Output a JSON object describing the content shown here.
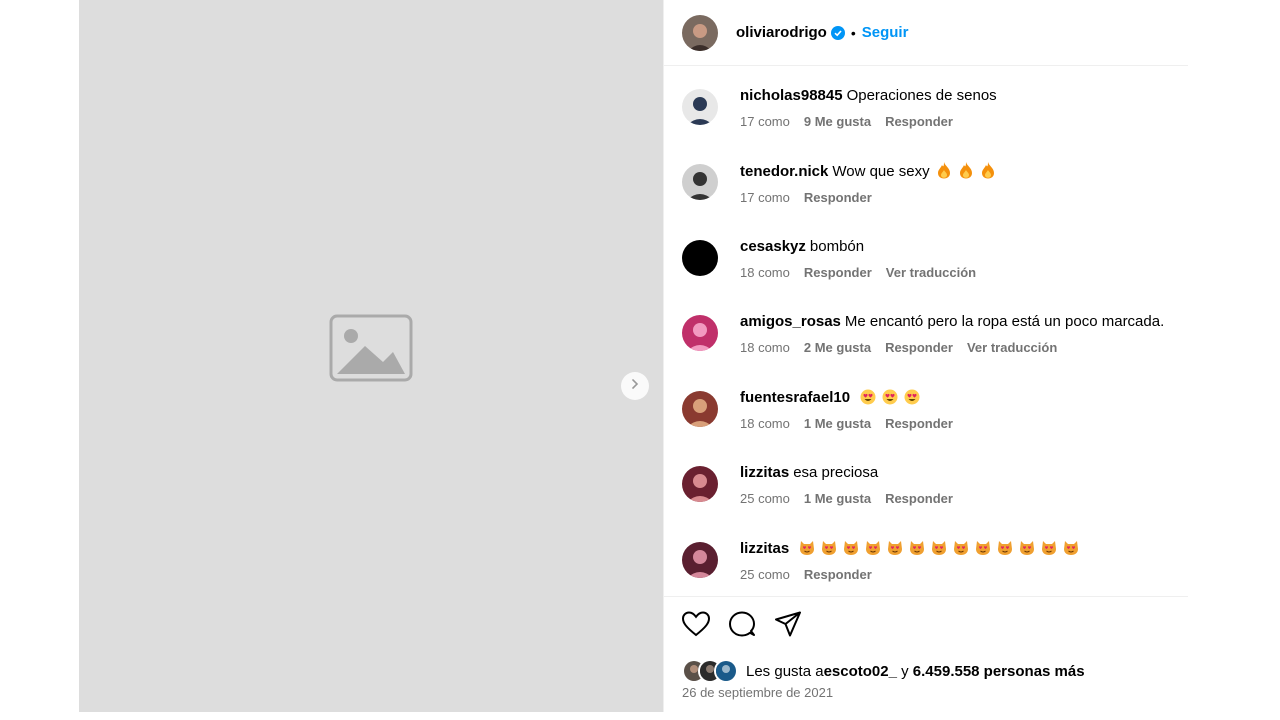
{
  "post": {
    "author": "oliviarodrigo",
    "separator": "•",
    "follow_label": "Seguir",
    "verified_icon": "verified-badge-icon",
    "accent_color": "#0095f6",
    "photo_alt": "Photo not reproduced"
  },
  "comments": [
    {
      "user": "nicholas98845",
      "text": "Operaciones de senos",
      "emoji": "",
      "emoji_count": 0,
      "time": "17 como",
      "likes": "9 Me gusta",
      "reply": "Responder",
      "translate": ""
    },
    {
      "user": "tenedor.nick",
      "text": "Wow que sexy",
      "emoji": "fire-emoji",
      "emoji_count": 3,
      "time": "17 como",
      "likes": "",
      "reply": "Responder",
      "translate": ""
    },
    {
      "user": "cesaskyz",
      "text": "bombón",
      "emoji": "",
      "emoji_count": 0,
      "time": "18 como",
      "likes": "",
      "reply": "Responder",
      "translate": "Ver traducción"
    },
    {
      "user": "amigos_rosas",
      "text": "Me encantó pero la ropa está un poco marcada.",
      "emoji": "",
      "emoji_count": 0,
      "time": "18 como",
      "likes": "2 Me gusta",
      "reply": "Responder",
      "translate": "Ver traducción"
    },
    {
      "user": "fuentesrafael10",
      "text": "",
      "emoji": "heart-eyes-emoji",
      "emoji_count": 3,
      "time": "18 como",
      "likes": "1 Me gusta",
      "reply": "Responder",
      "translate": ""
    },
    {
      "user": "lizzitas",
      "text": "esa preciosa",
      "emoji": "",
      "emoji_count": 0,
      "time": "25 como",
      "likes": "1 Me gusta",
      "reply": "Responder",
      "translate": ""
    },
    {
      "user": "lizzitas",
      "text": "",
      "emoji": "heart-eyes-cat-emoji",
      "emoji_count": 13,
      "time": "25 como",
      "likes": "",
      "reply": "Responder",
      "translate": ""
    }
  ],
  "actions": {
    "like_icon": "heart-icon",
    "comment_icon": "comment-bubble-icon",
    "share_icon": "paper-plane-icon"
  },
  "likes": {
    "prefix": "Les gusta a",
    "user": "escoto02_",
    "middle": "y",
    "count": "6.459.558 personas más"
  },
  "date": "26 de septiembre de 2021"
}
